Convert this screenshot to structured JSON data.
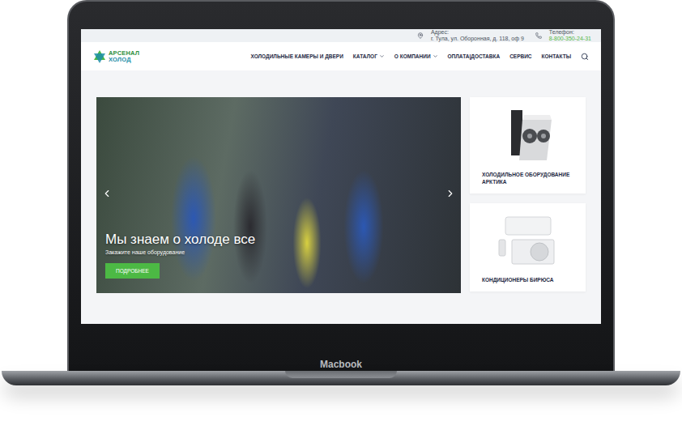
{
  "device": {
    "label": "Macbook"
  },
  "topbar": {
    "address": {
      "label": "Адрес:",
      "value": "г. Тула, ул. Оборонная, д. 118, оф 9"
    },
    "phone": {
      "label": "Телефон:",
      "value": "8-800-350-24-31"
    }
  },
  "logo": {
    "lines": [
      "АРСЕНАЛ",
      "ХОЛОД"
    ]
  },
  "nav": [
    {
      "label": "ХОЛОДИЛЬНЫЕ КАМЕРЫ И ДВЕРИ",
      "dropdown": false
    },
    {
      "label": "КАТАЛОГ",
      "dropdown": true
    },
    {
      "label": "О КОМПАНИИ",
      "dropdown": true
    },
    {
      "label": "ОПЛАТА|ДОСТАВКА",
      "dropdown": false
    },
    {
      "label": "СЕРВИС",
      "dropdown": false
    },
    {
      "label": "КОНТАКТЫ",
      "dropdown": false
    }
  ],
  "slider": {
    "title": "Мы знаем о холоде все",
    "subtitle": "Закажите наше оборудование",
    "button": "ПОДРОБНЕЕ"
  },
  "cards": [
    {
      "label": "ХОЛОДИЛЬНОЕ ОБОРУДОВАНИЕ АРКТИКА",
      "kind": "condenser"
    },
    {
      "label": "КОНДИЦИОНЕРЫ БИРЮСА",
      "kind": "aircon"
    }
  ]
}
